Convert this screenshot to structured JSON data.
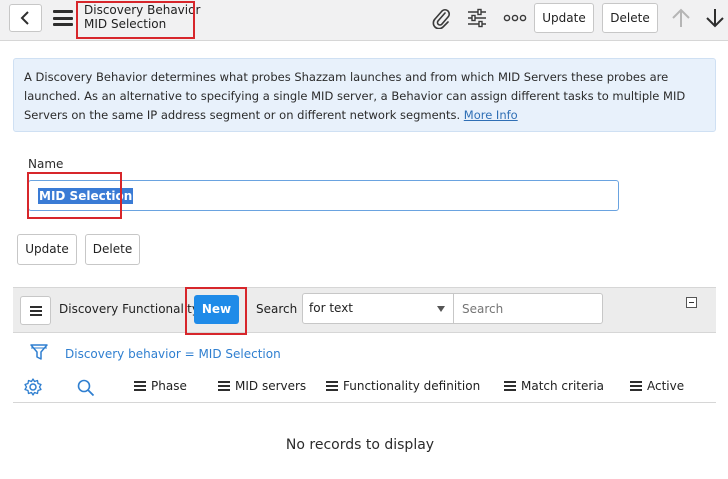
{
  "header": {
    "title_line1": "Discovery Behavior",
    "title_line2": "MID Selection",
    "update_label": "Update",
    "delete_label": "Delete"
  },
  "info": {
    "text": "A Discovery Behavior determines what probes Shazzam launches and from which MID Servers these probes are launched. As an alternative to specifying a single MID server, a Behavior can assign different tasks to multiple MID Servers on the same IP address segment or on different network segments.",
    "link": "More Info"
  },
  "form": {
    "name_label": "Name",
    "name_value": "MID Selection",
    "update_label": "Update",
    "delete_label": "Delete"
  },
  "related_list": {
    "title": "Discovery Functionality",
    "new_label": "New",
    "search_label": "Search",
    "search_field": "for text",
    "search_placeholder": "Search",
    "filter": "Discovery behavior = MID Selection",
    "columns": [
      "Phase",
      "MID servers",
      "Functionality definition",
      "Match criteria",
      "Active"
    ],
    "empty": "No records to display"
  },
  "colors": {
    "accent": "#1f8be8",
    "highlight": "#d7262b",
    "link": "#2f7fd0"
  }
}
